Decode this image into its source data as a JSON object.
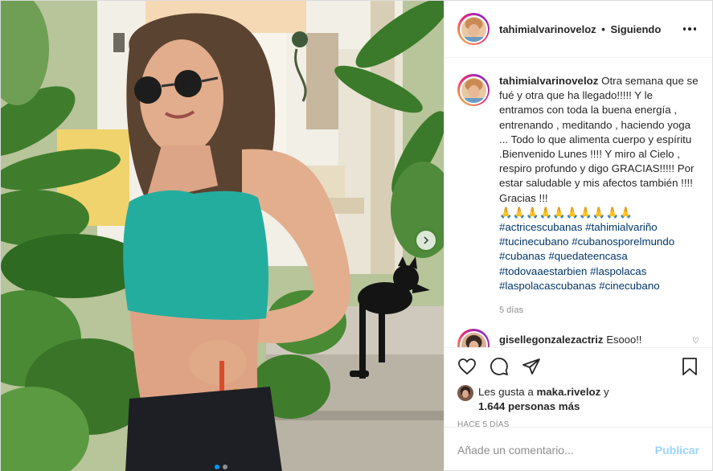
{
  "post": {
    "author": "tahimialvarinoveloz",
    "separator": "•",
    "follow_state": "Siguiendo",
    "caption_lines": [
      "Otra semana que se fué y otra que ha llegado!!!!! Y le entramos con toda la buena energía , entrenando , meditando , haciendo yoga ...",
      "Todo lo que alimenta cuerpo y espíritu .Bienvenido Lunes !!!! Y miro al Cielo , respiro profundo y digo GRACIAS!!!!! Por estar saludable y mis afectos también !!!! Gracias !!!"
    ],
    "emoji_row": "🙏🙏🙏🙏🙏🙏🙏🙏🙏🙏",
    "hashtags": [
      "#actricescubanas",
      "#tahimialvariño",
      "#tucinecubano",
      "#cubanosporelmundo",
      "#cubanas",
      "#quedateencasa",
      "#todovaaestarbien",
      "#laspolacas",
      "#laspolacascubanas",
      "#cinecubano"
    ],
    "caption_age": "5 días",
    "comment": {
      "author": "gisellegonzalezactriz",
      "text": "Esooo!!"
    },
    "likes": {
      "prefix": "Les gusta a",
      "user": "maka.riveloz",
      "joiner": "y",
      "count_text": "1.644 personas más"
    },
    "posted_ago": "HACE 5 DÍAS",
    "comment_placeholder": "Añade un comentario...",
    "publish_label": "Publicar"
  },
  "carousel": {
    "slide_index": 1,
    "slide_count": 2
  },
  "colors": {
    "accent": "#0095f6",
    "text": "#262626",
    "muted": "#8e8e8e",
    "hashtag": "#00376b"
  }
}
